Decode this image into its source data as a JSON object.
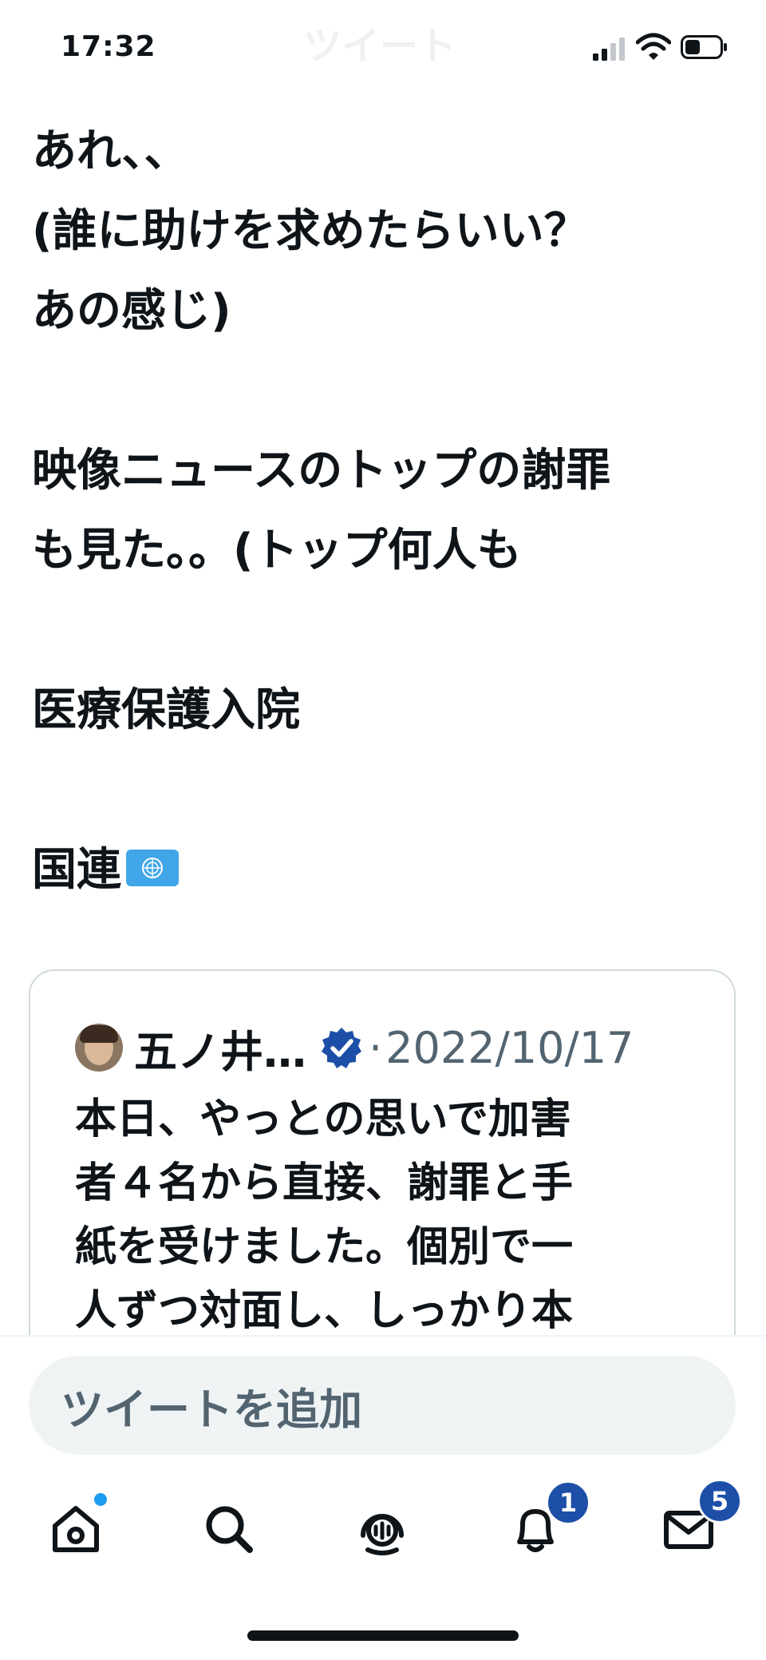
{
  "status_bar": {
    "time": "17:32",
    "ghost_title": "ツイート"
  },
  "tweet": {
    "lines": [
      "あれ、、",
      "(誰に助けを求めたらいい？",
      "あの感じ)",
      "",
      "映像ニュースのトップの謝罪",
      "も見た。。(トップ何人も",
      "",
      "医療保護入院",
      "",
      "国連"
    ],
    "flag_icon": "un-flag-icon"
  },
  "quoted_tweet": {
    "author": "五ノ井…",
    "separator": "·",
    "date": "2022/10/17",
    "verified_icon": "verified-badge-icon",
    "lines": [
      "本日、やっとの思いで加害",
      "者４名から直接、謝罪と手",
      "紙を受けました。個別で一",
      "人ずつ対面し、しっかり本"
    ]
  },
  "composer": {
    "placeholder": "ツイートを追加"
  },
  "tab_bar": {
    "items": [
      {
        "name": "home",
        "icon": "home-icon",
        "has_dot": true
      },
      {
        "name": "search",
        "icon": "search-icon"
      },
      {
        "name": "spaces",
        "icon": "spaces-icon"
      },
      {
        "name": "notifications",
        "icon": "bell-icon",
        "badge": "1"
      },
      {
        "name": "messages",
        "icon": "mail-icon",
        "badge": "5"
      }
    ]
  },
  "colors": {
    "accent": "#1d9bf0",
    "badge": "#1d4fa8",
    "text": "#0f1419",
    "muted": "#536471"
  }
}
